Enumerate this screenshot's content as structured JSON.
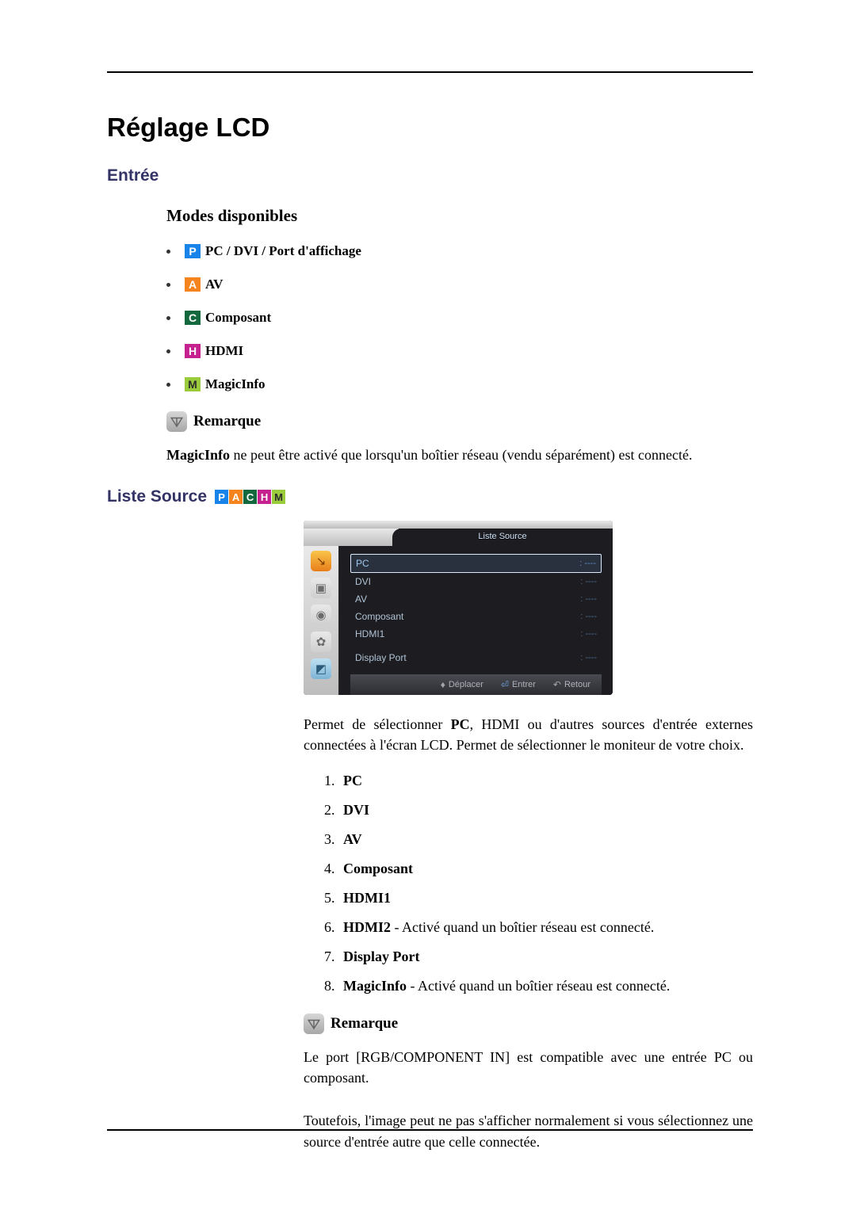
{
  "title": "Réglage LCD",
  "section_entree": "Entrée",
  "modes_head": "Modes disponibles",
  "modes": {
    "pc": {
      "letter": "P",
      "label": "PC / DVI / Port d'affichage"
    },
    "av": {
      "letter": "A",
      "label": "AV"
    },
    "comp": {
      "letter": "C",
      "label": "Composant"
    },
    "hdmi": {
      "letter": "H",
      "label": "HDMI"
    },
    "magic": {
      "letter": "M",
      "label": "MagicInfo"
    }
  },
  "note_label": "Remarque",
  "note_magicinfo_strong": "MagicInfo",
  "note_magicinfo_text": " ne peut être activé que lorsqu'un boîtier réseau (vendu séparément) est connecté.",
  "liste_source_label": "Liste Source",
  "badge_letters": {
    "p": "P",
    "a": "A",
    "c": "C",
    "h": "H",
    "m": "M"
  },
  "osd": {
    "title": "Liste Source",
    "rows": [
      {
        "name": "PC",
        "val": ": ----",
        "selected": true
      },
      {
        "name": "DVI",
        "val": ": ----",
        "selected": false
      },
      {
        "name": "AV",
        "val": ": ----",
        "selected": false
      },
      {
        "name": "Composant",
        "val": ": ----",
        "selected": false
      },
      {
        "name": "HDMI1",
        "val": ": ----",
        "selected": false
      },
      {
        "name": "",
        "val": "",
        "selected": false
      },
      {
        "name": "Display Port",
        "val": ": ----",
        "selected": false
      }
    ],
    "footer": {
      "move": "Déplacer",
      "enter": "Entrer",
      "return": "Retour"
    }
  },
  "desc_para": "Permet de sélectionner PC, HDMI ou d'autres sources d'entrée externes connectées à l'écran LCD. Permet de sélectionner le moniteur de votre choix.",
  "desc_strong": "PC",
  "src_list": {
    "1": {
      "strong": "PC",
      "rest": ""
    },
    "2": {
      "strong": "DVI",
      "rest": ""
    },
    "3": {
      "strong": "AV",
      "rest": ""
    },
    "4": {
      "strong": "Composant",
      "rest": ""
    },
    "5": {
      "strong": "HDMI1",
      "rest": ""
    },
    "6": {
      "strong": "HDMI2",
      "rest": " - Activé quand un boîtier réseau est connecté."
    },
    "7": {
      "strong": "Display Port",
      "rest": ""
    },
    "8": {
      "strong": "MagicInfo",
      "rest": " - Activé quand un boîtier réseau est connecté."
    }
  },
  "note2_para1": "Le port [RGB/COMPONENT IN] est compatible avec une entrée PC ou composant.",
  "note2_para2": "Toutefois, l'image peut ne pas s'afficher normalement si vous sélectionnez une source d'entrée autre que celle connectée."
}
